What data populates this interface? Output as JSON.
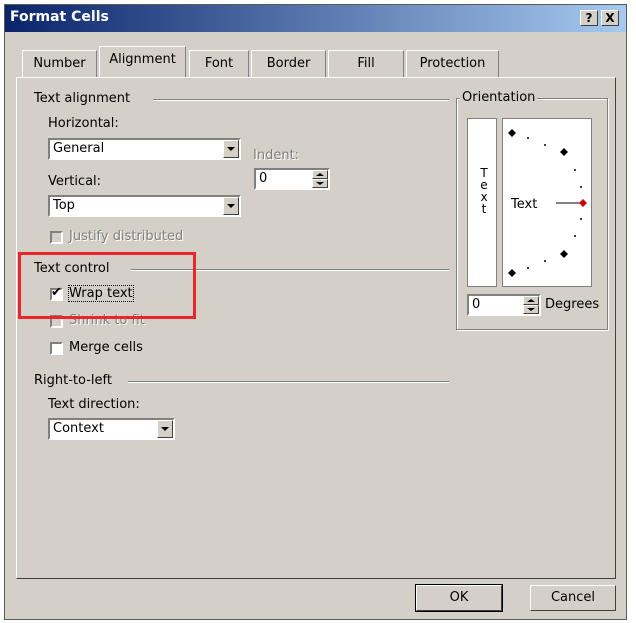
{
  "window": {
    "title": "Format Cells",
    "help": "?",
    "close": "X"
  },
  "tabs": [
    "Number",
    "Alignment",
    "Font",
    "Border",
    "Fill",
    "Protection"
  ],
  "active_tab": "Alignment",
  "text_alignment": {
    "group": "Text alignment",
    "horizontal_label": "Horizontal:",
    "horizontal_value": "General",
    "indent_label": "Indent:",
    "indent_value": "0",
    "vertical_label": "Vertical:",
    "vertical_value": "Top",
    "justify_distributed": "Justify distributed"
  },
  "text_control": {
    "group": "Text control",
    "wrap_text": "Wrap text",
    "wrap_checked": true,
    "shrink_to_fit": "Shrink to fit",
    "merge_cells": "Merge cells"
  },
  "rtl": {
    "group": "Right-to-left",
    "direction_label": "Text direction:",
    "direction_value": "Context"
  },
  "orientation": {
    "group": "Orientation",
    "vertical_text": [
      "T",
      "e",
      "x",
      "t"
    ],
    "dial_text": "Text",
    "degrees_value": "0",
    "degrees_label": "Degrees"
  },
  "buttons": {
    "ok": "OK",
    "cancel": "Cancel"
  },
  "colors": {
    "title_start": "#0a246a",
    "title_end": "#a6caf0",
    "dialog_bg": "#d4d0c8",
    "highlight": "#e8262b",
    "dial_marker": "#cc0000"
  }
}
